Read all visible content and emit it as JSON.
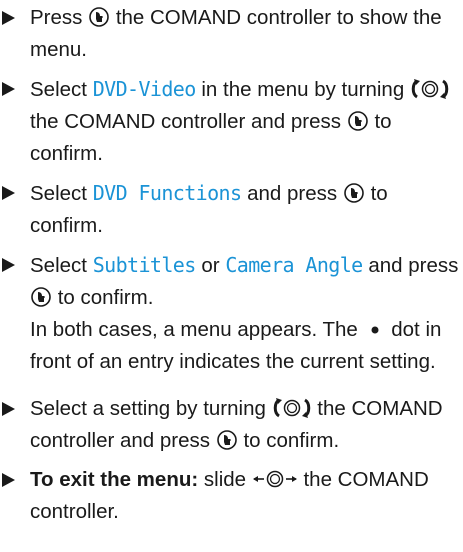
{
  "steps": [
    {
      "press_prefix": "Press",
      "press_suffix": "the COMAND controller to show the menu."
    },
    {
      "select": "Select",
      "item": "DVD-Video",
      "mid": "in the menu by turning",
      "after_turn": "the COMAND controller and press",
      "end": "to confirm."
    },
    {
      "select": "Select",
      "item": "DVD Functions",
      "mid": "and press",
      "end": "to confirm."
    },
    {
      "select": "Select",
      "item_a": "Subtitles",
      "or": "or",
      "item_b": "Camera Angle",
      "and": "and",
      "press": "press",
      "end": "to confirm.",
      "note_pre": "In both cases, a menu appears. The",
      "note_post": "dot in front of an entry indicates the current setting."
    },
    {
      "pre": "Select a setting by turning",
      "mid": "the COMAND controller and press",
      "end": "to confirm."
    },
    {
      "bold": "To exit the menu:",
      "pre": "slide",
      "post": "the COMAND controller."
    }
  ],
  "icons": {
    "bullet": "triangle-bullet-icon",
    "press": "press-controller-icon",
    "turn": "turn-controller-icon",
    "slide": "slide-controller-icon",
    "dot": "selection-dot-icon"
  },
  "colors": {
    "text": "#1a1a1a",
    "ui_term": "#1b93d6"
  }
}
